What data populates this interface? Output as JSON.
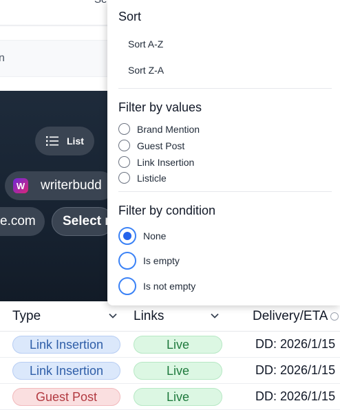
{
  "background": {
    "top_fragment": "Se",
    "search_fragment": "n",
    "view_pill_label": "List",
    "site_pill_label": "writerbudd",
    "domain_pill_label": "e.com",
    "select_pill_label": "Select r"
  },
  "table": {
    "columns": [
      "Type",
      "Links",
      "Delivery/ETA"
    ],
    "rows": [
      {
        "type": "Link Insertion",
        "type_color": "blue",
        "links": "Live",
        "delivery": "DD: 2026/1/15"
      },
      {
        "type": "Link Insertion",
        "type_color": "blue",
        "links": "Live",
        "delivery": "DD: 2026/1/15"
      },
      {
        "type": "Guest Post",
        "type_color": "red",
        "links": "Live",
        "delivery": "DD: 2026/1/15"
      }
    ]
  },
  "dropdown": {
    "sort_title": "Sort",
    "sort_options": [
      "Sort A-Z",
      "Sort Z-A"
    ],
    "filter_values_title": "Filter by values",
    "value_options": [
      "Brand Mention",
      "Guest Post",
      "Link Insertion",
      "Listicle"
    ],
    "filter_condition_title": "Filter by condition",
    "condition_options": [
      {
        "label": "None",
        "selected": true
      },
      {
        "label": "Is empty",
        "selected": false
      },
      {
        "label": "Is not empty",
        "selected": false
      }
    ]
  },
  "colors": {
    "accent": "#2563eb",
    "hero_bg": "#1e2b3b",
    "tag_blue": "#dbe8fb",
    "tag_red": "#fadfe0",
    "tag_live": "#dcf7e3"
  },
  "icons": {
    "list_view": "list-icon",
    "site_logo": "writerbuddy-logo-icon",
    "column_menu": "chevron-down-icon",
    "info": "info-icon"
  }
}
